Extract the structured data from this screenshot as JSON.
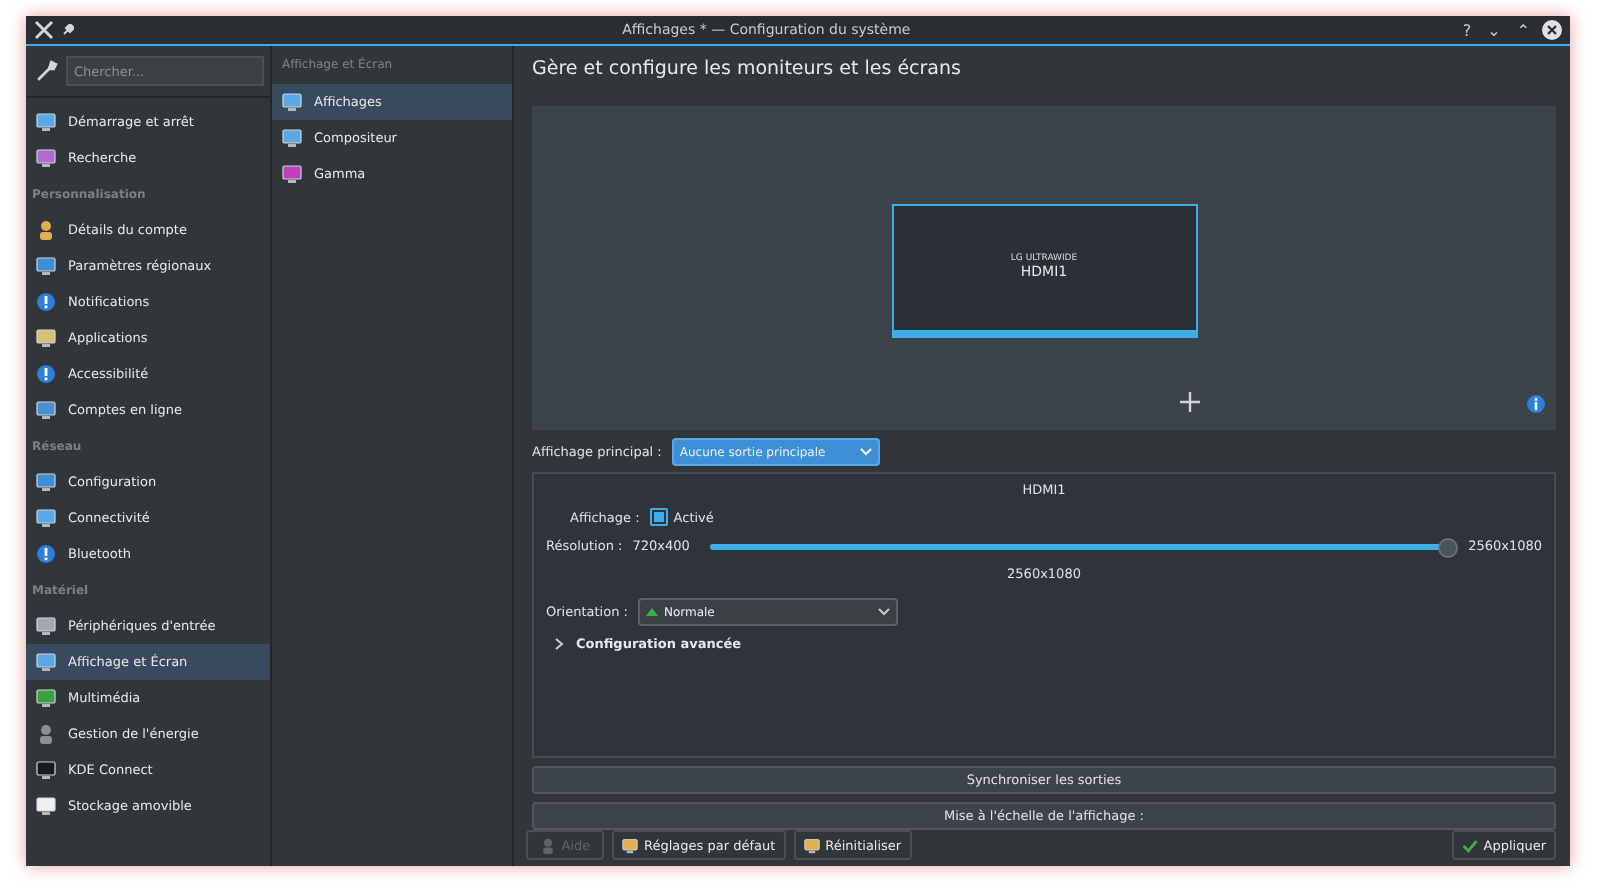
{
  "window": {
    "title": "Affichages * — Configuration du système",
    "buttons": [
      "?",
      "⌄",
      "⌃"
    ]
  },
  "sidebar": {
    "search": {
      "placeholder": "Chercher..."
    },
    "items": [
      {
        "kind": "item",
        "label": "Démarrage et arrêt",
        "selected": false
      },
      {
        "kind": "item",
        "label": "Recherche",
        "selected": false
      },
      {
        "kind": "header",
        "label": "Personnalisation"
      },
      {
        "kind": "item",
        "label": "Détails du compte",
        "selected": false
      },
      {
        "kind": "item",
        "label": "Paramètres régionaux",
        "selected": false
      },
      {
        "kind": "item",
        "label": "Notifications",
        "selected": false
      },
      {
        "kind": "item",
        "label": "Applications",
        "selected": false
      },
      {
        "kind": "item",
        "label": "Accessibilité",
        "selected": false
      },
      {
        "kind": "item",
        "label": "Comptes en ligne",
        "selected": false
      },
      {
        "kind": "header",
        "label": "Réseau"
      },
      {
        "kind": "item",
        "label": "Configuration",
        "selected": false
      },
      {
        "kind": "item",
        "label": "Connectivité",
        "selected": false
      },
      {
        "kind": "item",
        "label": "Bluetooth",
        "selected": false
      },
      {
        "kind": "header",
        "label": "Matériel"
      },
      {
        "kind": "item",
        "label": "Périphériques d'entrée",
        "selected": false
      },
      {
        "kind": "item",
        "label": "Affichage et Écran",
        "selected": true
      },
      {
        "kind": "item",
        "label": "Multimédia",
        "selected": false
      },
      {
        "kind": "item",
        "label": "Gestion de l'énergie",
        "selected": false
      },
      {
        "kind": "item",
        "label": "KDE Connect",
        "selected": false
      },
      {
        "kind": "item",
        "label": "Stockage amovible",
        "selected": false
      }
    ]
  },
  "subpanel": {
    "title": "Affichage et Écran",
    "items": [
      {
        "label": "Affichages",
        "selected": true
      },
      {
        "label": "Compositeur",
        "selected": false
      },
      {
        "label": "Gamma",
        "selected": false
      }
    ]
  },
  "main": {
    "heading": "Gère et configure les moniteurs et les écrans",
    "screen": {
      "brand": "LG ULTRAWIDE",
      "output": "HDMI1"
    },
    "primary": {
      "label": "Affichage principal :",
      "value": "Aucune sortie principale"
    },
    "output": {
      "title": "HDMI1",
      "display_label": "Affichage :",
      "enabled_label": "Activé",
      "enabled": true,
      "resolution_label": "Résolution :",
      "min": "720x400",
      "max": "2560x1080",
      "level": 1,
      "current": "2560x1080",
      "orientation_label": "Orientation :",
      "orientation": "Normale",
      "advanced": "Configuration avancée",
      "advanced_expanded": false
    },
    "sync_button": "Synchroniser les sorties",
    "scale_button": "Mise à l'échelle de l'affichage :"
  },
  "footer": [
    {
      "label": "Aide",
      "disabled": true
    },
    {
      "label": "Réglages par défaut",
      "disabled": false
    },
    {
      "label": "Réinitialiser",
      "disabled": false
    },
    {
      "label": "Appliquer",
      "disabled": false
    }
  ]
}
